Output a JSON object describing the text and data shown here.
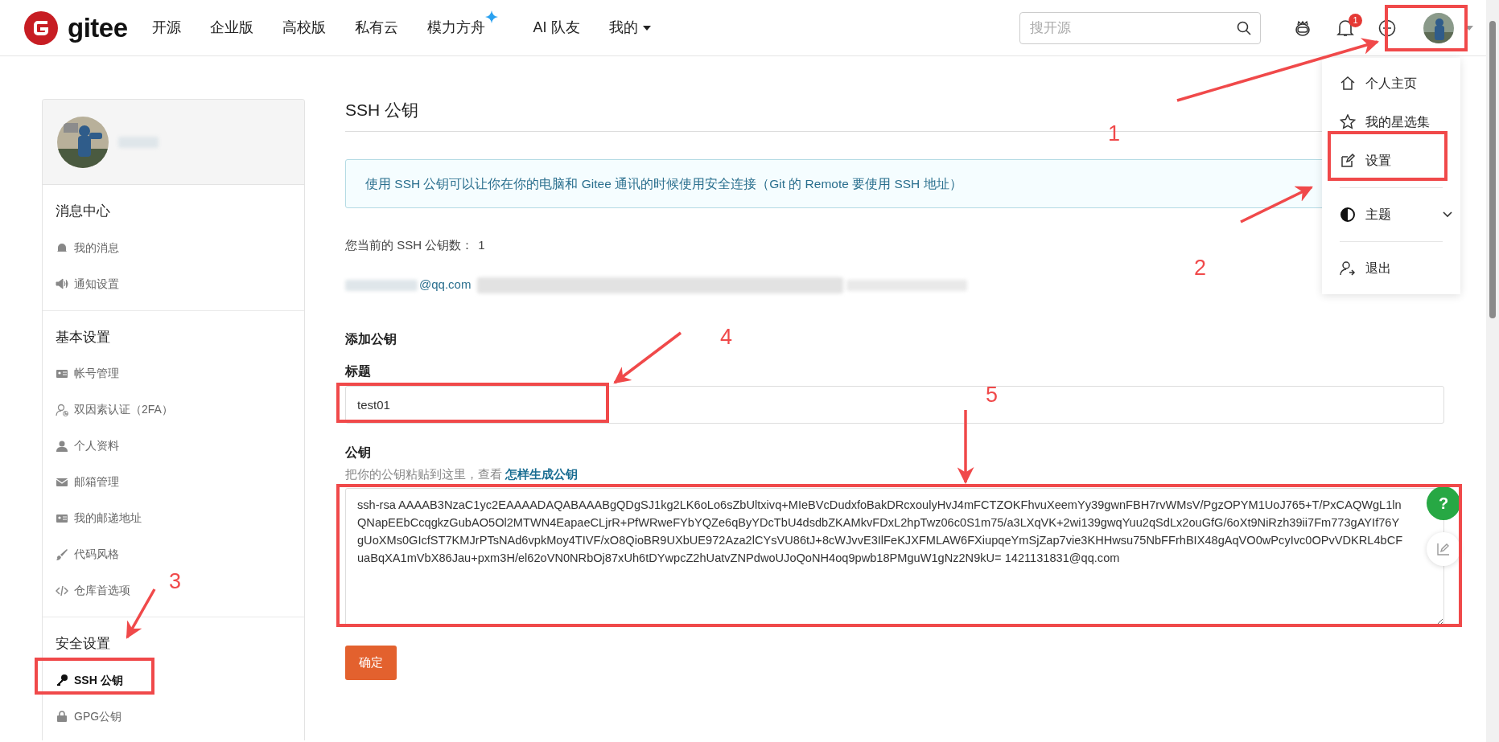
{
  "navbar": {
    "logo_text": "gitee",
    "links": [
      {
        "label": "开源",
        "sparkle": false,
        "dropdown": false
      },
      {
        "label": "企业版",
        "sparkle": false,
        "dropdown": false
      },
      {
        "label": "高校版",
        "sparkle": false,
        "dropdown": false
      },
      {
        "label": "私有云",
        "sparkle": false,
        "dropdown": false
      },
      {
        "label": "模力方舟",
        "sparkle": true,
        "dropdown": false
      },
      {
        "label": "AI 队友",
        "sparkle": false,
        "dropdown": false
      },
      {
        "label": "我的",
        "sparkle": false,
        "dropdown": true
      }
    ],
    "search": {
      "placeholder": "搜开源"
    },
    "notification_count": "1"
  },
  "user_menu": {
    "items": [
      {
        "label": "个人主页",
        "kind": "link"
      },
      {
        "label": "我的星选集",
        "kind": "link"
      },
      {
        "label": "设置",
        "kind": "link"
      },
      {
        "label": "主题",
        "kind": "submenu"
      },
      {
        "label": "退出",
        "kind": "link"
      }
    ]
  },
  "sidebar": {
    "sections": [
      {
        "title": "消息中心",
        "items": [
          {
            "label": "我的消息",
            "selected": false
          },
          {
            "label": "通知设置",
            "selected": false
          }
        ]
      },
      {
        "title": "基本设置",
        "items": [
          {
            "label": "帐号管理",
            "selected": false
          },
          {
            "label": "双因素认证（2FA）",
            "selected": false
          },
          {
            "label": "个人资料",
            "selected": false
          },
          {
            "label": "邮箱管理",
            "selected": false
          },
          {
            "label": "我的邮递地址",
            "selected": false
          },
          {
            "label": "代码风格",
            "selected": false
          },
          {
            "label": "仓库首选项",
            "selected": false
          }
        ]
      },
      {
        "title": "安全设置",
        "items": [
          {
            "label": "SSH 公钥",
            "selected": true
          },
          {
            "label": "GPG公钥",
            "selected": false
          }
        ]
      }
    ]
  },
  "page": {
    "title": "SSH 公钥",
    "info": "使用 SSH 公钥可以让你在你的电脑和 Gitee 通讯的时候使用安全连接（Git 的 Remote 要使用 SSH 地址）",
    "key_count_label": "您当前的 SSH 公钥数：",
    "key_count": "1",
    "keys": [
      {
        "email": "@qq.com"
      }
    ],
    "form": {
      "heading": "添加公钥",
      "title_label": "标题",
      "title_value": "test01",
      "key_label": "公钥",
      "key_hint": "把你的公钥粘贴到这里，查看",
      "key_hint_link": "怎样生成公钥",
      "key_value": "ssh-rsa AAAAB3NzaC1yc2EAAAADAQABAAABgQDgSJ1kg2LK6oLo6sZbUltxivq+MIeBVcDudxfoBakDRcxoulyHvJ4mFCTZOKFhvuXeemYy39gwnFBH7rvWMsV/PgzOPYM1UoJ765+T/PxCAQWgL1lnQNapEEbCcqgkzGubAO5Ol2MTWN4EapaeCLjrR+PfWRweFYbYQZe6qByYDcTbU4dsdbZKAMkvFDxL2hpTwz06c0S1m75/a3LXqVK+2wi139gwqYuu2qSdLx2ouGfG/6oXt9NiRzh39ii7Fm773gAYIf76YgUoXMs0GIcfST7KMJrPTsNAd6vpkMoy4TIVF/xO8QioBR9UXbUE972Aza2lCYsVU86tJ+8cWJvvE3IlFeKJXFMLAW6FXiupqeYmSjZap7vie3KHHwsu75NbFFrhBIX48gAqVO0wPcyIvc0OPvVDKRL4bCFuaBqXA1mVbX86Jau+pxm3H/el62oVN0NRbOj87xUh6tDYwpcZ2hUatvZNPdwoUJoQoNH4oq9pwb18PMguW1gNz2N9kU= 1421131831@qq.com",
      "submit": "确定"
    }
  },
  "floating": {
    "help": "?"
  },
  "annotations": [
    {
      "label": "1"
    },
    {
      "label": "2"
    },
    {
      "label": "3"
    },
    {
      "label": "4"
    },
    {
      "label": "5"
    }
  ]
}
